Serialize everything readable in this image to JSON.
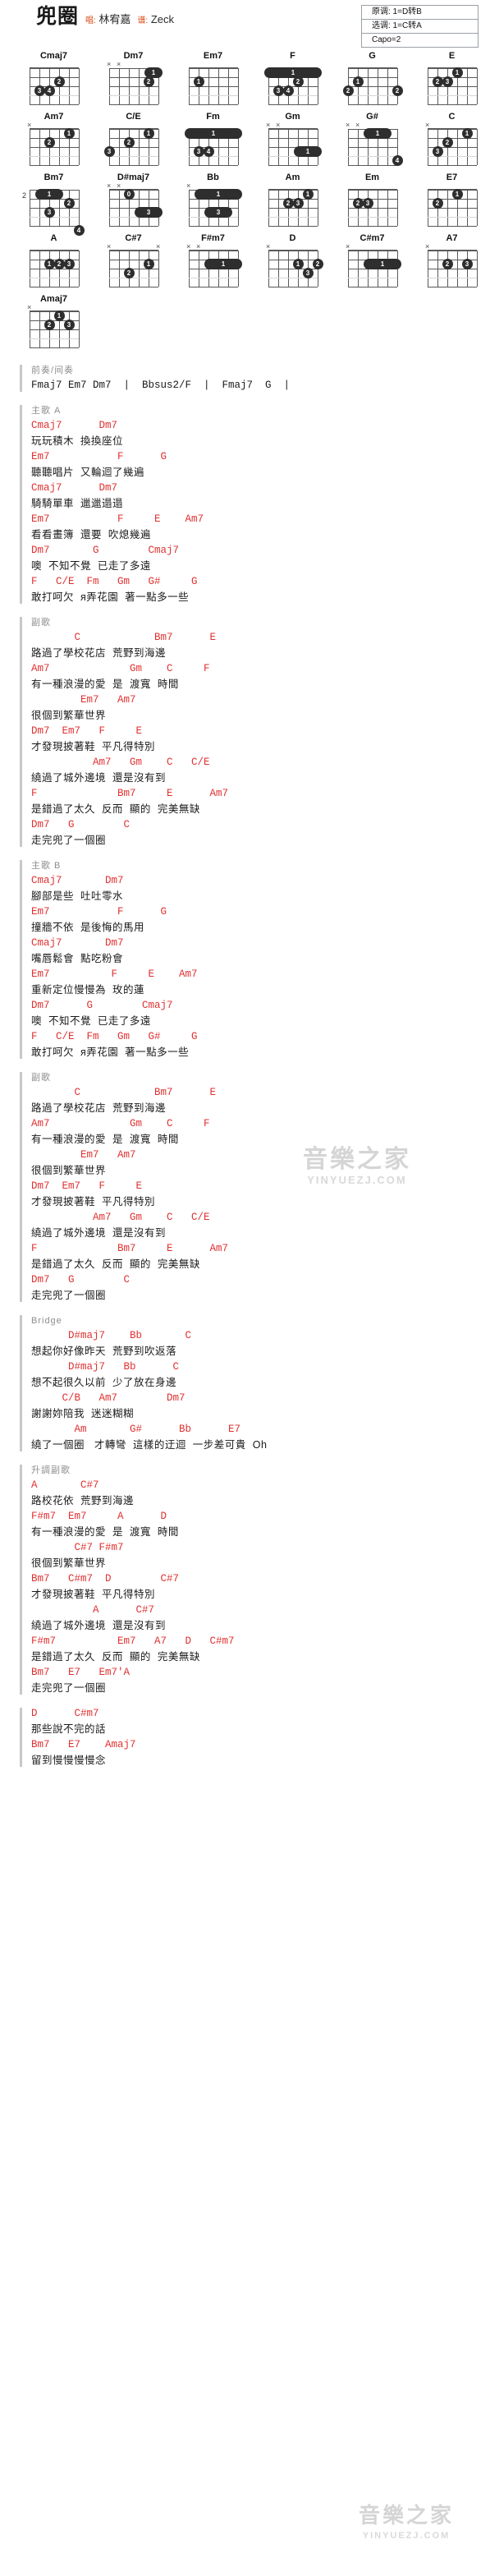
{
  "header": {
    "title": "兜圈",
    "singer_label": "唱:",
    "singer": "林宥嘉",
    "arranger_label": "谱:",
    "arranger": "Zeck",
    "key_original": "原调: 1=D转B",
    "key_selected": "选调: 1=C转A",
    "capo": "Capo=2"
  },
  "chords": [
    [
      {
        "name": "Cmaj7",
        "mutes": [],
        "fret": "",
        "dots": [
          {
            "s": 3,
            "f": 2,
            "n": "2"
          },
          {
            "s": 5,
            "f": 3,
            "n": "3"
          },
          {
            "s": 4,
            "f": 3,
            "n": "4"
          }
        ],
        "bars": []
      },
      {
        "name": "Dm7",
        "mutes": [
          6,
          5
        ],
        "fret": "",
        "dots": [
          {
            "s": 2,
            "f": 2,
            "n": "2"
          }
        ],
        "bars": [
          {
            "f": 1,
            "from": 1,
            "to": 2,
            "n": "1"
          }
        ]
      },
      {
        "name": "Em7",
        "mutes": [],
        "fret": "",
        "dots": [
          {
            "s": 5,
            "f": 2,
            "n": "1"
          }
        ],
        "bars": []
      },
      {
        "name": "F",
        "mutes": [],
        "fret": "",
        "dots": [
          {
            "s": 3,
            "f": 2,
            "n": "2"
          },
          {
            "s": 5,
            "f": 3,
            "n": "3"
          },
          {
            "s": 4,
            "f": 3,
            "n": "4"
          }
        ],
        "bars": [
          {
            "f": 1,
            "from": 1,
            "to": 6,
            "n": "1"
          }
        ]
      },
      {
        "name": "G",
        "mutes": [],
        "fret": "",
        "dots": [
          {
            "s": 5,
            "f": 2,
            "n": "1"
          },
          {
            "s": 6,
            "f": 3,
            "n": "2"
          },
          {
            "s": 1,
            "f": 3,
            "n": "2"
          }
        ],
        "bars": []
      },
      {
        "name": "E",
        "mutes": [],
        "fret": "",
        "dots": [
          {
            "s": 3,
            "f": 1,
            "n": "1"
          },
          {
            "s": 5,
            "f": 2,
            "n": "2"
          },
          {
            "s": 4,
            "f": 2,
            "n": "3"
          }
        ],
        "bars": []
      }
    ],
    [
      {
        "name": "Am7",
        "mutes": [
          6
        ],
        "fret": "",
        "dots": [
          {
            "s": 2,
            "f": 1,
            "n": "1"
          },
          {
            "s": 4,
            "f": 2,
            "n": "2"
          }
        ],
        "bars": []
      },
      {
        "name": "C/E",
        "mutes": [],
        "fret": "",
        "dots": [
          {
            "s": 2,
            "f": 1,
            "n": "1"
          },
          {
            "s": 4,
            "f": 2,
            "n": "2"
          },
          {
            "s": 6,
            "f": 3,
            "n": "3"
          }
        ],
        "bars": []
      },
      {
        "name": "Fm",
        "mutes": [],
        "fret": "",
        "dots": [
          {
            "s": 5,
            "f": 3,
            "n": "3"
          },
          {
            "s": 4,
            "f": 3,
            "n": "4"
          }
        ],
        "bars": [
          {
            "f": 1,
            "from": 1,
            "to": 6,
            "n": "1"
          }
        ]
      },
      {
        "name": "Gm",
        "mutes": [
          6,
          5
        ],
        "fret": "",
        "dots": [],
        "bars": [
          {
            "f": 3,
            "from": 1,
            "to": 3,
            "n": "1"
          }
        ]
      },
      {
        "name": "G#",
        "mutes": [
          6,
          5
        ],
        "fret": "",
        "dots": [
          {
            "s": 1,
            "f": 4,
            "n": "4"
          }
        ],
        "bars": [
          {
            "f": 1,
            "from": 2,
            "to": 4,
            "n": "1"
          }
        ]
      },
      {
        "name": "C",
        "mutes": [
          6
        ],
        "fret": "",
        "dots": [
          {
            "s": 2,
            "f": 1,
            "n": "1"
          },
          {
            "s": 4,
            "f": 2,
            "n": "2"
          },
          {
            "s": 5,
            "f": 3,
            "n": "3"
          }
        ],
        "bars": []
      }
    ],
    [
      {
        "name": "Bm7",
        "mutes": [],
        "fret": "2",
        "dots": [
          {
            "s": 2,
            "f": 2,
            "n": "2"
          },
          {
            "s": 4,
            "f": 3,
            "n": "3"
          },
          {
            "s": 1,
            "f": 5,
            "n": "4"
          }
        ],
        "bars": [
          {
            "f": 1,
            "from": 3,
            "to": 5,
            "n": "1"
          }
        ]
      },
      {
        "name": "D#maj7",
        "mutes": [
          6,
          5
        ],
        "fret": "",
        "dots": [
          {
            "s": 4,
            "f": 1,
            "n": "0"
          }
        ],
        "bars": [
          {
            "f": 3,
            "from": 1,
            "to": 3,
            "n": "3"
          }
        ]
      },
      {
        "name": "Bb",
        "mutes": [
          6
        ],
        "fret": "",
        "dots": [],
        "bars": [
          {
            "f": 1,
            "from": 1,
            "to": 5,
            "n": "1"
          },
          {
            "f": 3,
            "from": 2,
            "to": 4,
            "n": "3"
          }
        ]
      },
      {
        "name": "Am",
        "mutes": [],
        "fret": "",
        "dots": [
          {
            "s": 2,
            "f": 1,
            "n": "1"
          },
          {
            "s": 4,
            "f": 2,
            "n": "2"
          },
          {
            "s": 3,
            "f": 2,
            "n": "3"
          }
        ],
        "bars": []
      },
      {
        "name": "Em",
        "mutes": [],
        "fret": "",
        "dots": [
          {
            "s": 5,
            "f": 2,
            "n": "2"
          },
          {
            "s": 4,
            "f": 2,
            "n": "3"
          }
        ],
        "bars": []
      },
      {
        "name": "E7",
        "mutes": [],
        "fret": "",
        "dots": [
          {
            "s": 3,
            "f": 1,
            "n": "1"
          },
          {
            "s": 5,
            "f": 2,
            "n": "2"
          }
        ],
        "bars": []
      }
    ],
    [
      {
        "name": "A",
        "mutes": [],
        "fret": "",
        "dots": [
          {
            "s": 4,
            "f": 2,
            "n": "1"
          },
          {
            "s": 3,
            "f": 2,
            "n": "2"
          },
          {
            "s": 2,
            "f": 2,
            "n": "3"
          }
        ],
        "bars": []
      },
      {
        "name": "C#7",
        "mutes": [
          6,
          1
        ],
        "fret": "",
        "dots": [
          {
            "s": 2,
            "f": 2,
            "n": "1"
          },
          {
            "s": 4,
            "f": 3,
            "n": "2"
          }
        ],
        "bars": []
      },
      {
        "name": "F#m7",
        "mutes": [
          6,
          5
        ],
        "fret": "",
        "dots": [],
        "bars": [
          {
            "f": 2,
            "from": 1,
            "to": 4,
            "n": "1"
          }
        ]
      },
      {
        "name": "D",
        "mutes": [
          6
        ],
        "fret": "",
        "dots": [
          {
            "s": 3,
            "f": 2,
            "n": "1"
          },
          {
            "s": 1,
            "f": 2,
            "n": "2"
          },
          {
            "s": 2,
            "f": 3,
            "n": "3"
          }
        ],
        "bars": []
      },
      {
        "name": "C#m7",
        "mutes": [
          6
        ],
        "fret": "",
        "dots": [],
        "bars": [
          {
            "f": 2,
            "from": 1,
            "to": 4,
            "n": "1"
          }
        ]
      },
      {
        "name": "A7",
        "mutes": [
          6
        ],
        "fret": "",
        "dots": [
          {
            "s": 4,
            "f": 2,
            "n": "2"
          },
          {
            "s": 2,
            "f": 2,
            "n": "3"
          }
        ],
        "bars": []
      }
    ],
    [
      {
        "name": "Amaj7",
        "mutes": [
          6
        ],
        "fret": "",
        "dots": [
          {
            "s": 3,
            "f": 1,
            "n": "1"
          },
          {
            "s": 4,
            "f": 2,
            "n": "2"
          },
          {
            "s": 2,
            "f": 2,
            "n": "3"
          }
        ],
        "bars": []
      }
    ]
  ],
  "sections": [
    {
      "label": "前奏/间奏",
      "lines": [
        {
          "type": "interlude",
          "text": "Fmaj7 Em7 Dm7  |  Bbsus2/F  |  Fmaj7  G  |"
        }
      ]
    },
    {
      "label": "主歌 A",
      "lines": [
        {
          "type": "chords",
          "text": "Cmaj7      Dm7"
        },
        {
          "type": "lyric",
          "text": "玩玩積木  換換座位"
        },
        {
          "type": "chords",
          "text": "Em7           F      G"
        },
        {
          "type": "lyric",
          "text": "聽聽唱片  又輪迴了幾遍"
        },
        {
          "type": "chords",
          "text": "Cmaj7      Dm7"
        },
        {
          "type": "lyric",
          "text": "騎騎單車  邋邋遢遢"
        },
        {
          "type": "chords",
          "text": "Em7           F     E    Am7"
        },
        {
          "type": "lyric",
          "text": "看看畫簿  還要  吹熄幾遍"
        },
        {
          "type": "chords",
          "text": "Dm7       G        Cmaj7"
        },
        {
          "type": "lyric",
          "text": "噢  不知不覺  已走了多遠"
        },
        {
          "type": "chords",
          "text": "F   C/E  Fm   Gm   G#     G"
        },
        {
          "type": "lyric",
          "text": "敢打呵欠  я弄花園  著一點多一些"
        }
      ]
    },
    {
      "label": "副歌",
      "lines": [
        {
          "type": "chords",
          "text": "       C            Bm7      E"
        },
        {
          "type": "lyric",
          "text": "路過了學校花店  荒野到海邊"
        },
        {
          "type": "chords",
          "text": "Am7             Gm    C     F"
        },
        {
          "type": "lyric",
          "text": "有一種浪漫的愛  是  渡寬  時間"
        },
        {
          "type": "chords",
          "text": "        Em7   Am7"
        },
        {
          "type": "lyric",
          "text": "很個到繁華世界"
        },
        {
          "type": "chords",
          "text": "Dm7  Em7   F     E"
        },
        {
          "type": "lyric",
          "text": "才發現披著鞋  平凡得特別"
        },
        {
          "type": "chords",
          "text": "          Am7   Gm    C   C/E"
        },
        {
          "type": "lyric",
          "text": "繞過了城外邊境  還是沒有到"
        },
        {
          "type": "chords",
          "text": "F             Bm7     E      Am7"
        },
        {
          "type": "lyric",
          "text": "是錯過了太久  反而  顯的  完美無缺"
        },
        {
          "type": "chords",
          "text": "Dm7   G        C"
        },
        {
          "type": "lyric",
          "text": "走完兜了一個圈"
        }
      ]
    },
    {
      "label": "主歌 B",
      "lines": [
        {
          "type": "chords",
          "text": "Cmaj7       Dm7"
        },
        {
          "type": "lyric",
          "text": "腳部是些  吐吐零水"
        },
        {
          "type": "chords",
          "text": "Em7           F      G"
        },
        {
          "type": "lyric",
          "text": "撞牆不依  是後悔的馬用"
        },
        {
          "type": "chords",
          "text": "Cmaj7       Dm7"
        },
        {
          "type": "lyric",
          "text": "嘴唇鬆會  點吃粉會"
        },
        {
          "type": "chords",
          "text": "Em7          F     E    Am7"
        },
        {
          "type": "lyric",
          "text": "重新定位慢慢為  玫的蓮"
        },
        {
          "type": "chords",
          "text": "Dm7      G        Cmaj7"
        },
        {
          "type": "lyric",
          "text": "噢  不知不覺  已走了多遠"
        },
        {
          "type": "chords",
          "text": "F   C/E  Fm   Gm   G#     G"
        },
        {
          "type": "lyric",
          "text": "敢打呵欠  я弄花園  著一點多一些"
        }
      ]
    },
    {
      "label": "副歌",
      "lines": [
        {
          "type": "chords",
          "text": "       C            Bm7      E"
        },
        {
          "type": "lyric",
          "text": "路過了學校花店  荒野到海邊"
        },
        {
          "type": "chords",
          "text": "Am7             Gm    C     F"
        },
        {
          "type": "lyric",
          "text": "有一種浪漫的愛  是  渡寬  時間"
        },
        {
          "type": "chords",
          "text": "        Em7   Am7"
        },
        {
          "type": "lyric",
          "text": "很個到繁華世界"
        },
        {
          "type": "chords",
          "text": "Dm7  Em7   F     E"
        },
        {
          "type": "lyric",
          "text": "才發現披著鞋  平凡得特別"
        },
        {
          "type": "chords",
          "text": "          Am7   Gm    C   C/E"
        },
        {
          "type": "lyric",
          "text": "繞過了城外邊境  還是沒有到"
        },
        {
          "type": "chords",
          "text": "F             Bm7     E      Am7"
        },
        {
          "type": "lyric",
          "text": "是錯過了太久  反而  顯的  完美無缺"
        },
        {
          "type": "chords",
          "text": "Dm7   G        C"
        },
        {
          "type": "lyric",
          "text": "走完兜了一個圈"
        }
      ]
    },
    {
      "label": "Bridge",
      "lines": [
        {
          "type": "chords",
          "text": "      D#maj7    Bb       C"
        },
        {
          "type": "lyric",
          "text": "想起你好像昨天  荒野到吹返落"
        },
        {
          "type": "chords",
          "text": "      D#maj7   Bb      C"
        },
        {
          "type": "lyric",
          "text": "想不起很久以前  少了放在身邊"
        },
        {
          "type": "chords",
          "text": "     C/B   Am7        Dm7"
        },
        {
          "type": "lyric",
          "text": "謝謝妳陪我  迷迷糊糊"
        },
        {
          "type": "chords",
          "text": "       Am       G#      Bb      E7"
        },
        {
          "type": "lyric",
          "text": "繞了一個圈   才轉彎  這樣的迂迴  一步差可貴  Oh"
        }
      ]
    },
    {
      "label": "升調副歌",
      "lines": [
        {
          "type": "chords",
          "text": "A       C#7"
        },
        {
          "type": "lyric",
          "text": "路校花依  荒野到海邊"
        },
        {
          "type": "chords",
          "text": "F#m7  Em7     A      D"
        },
        {
          "type": "lyric",
          "text": "有一種浪漫的愛  是  渡寬  時間"
        },
        {
          "type": "chords",
          "text": "       C#7 F#m7"
        },
        {
          "type": "lyric",
          "text": "很個到繁華世界"
        },
        {
          "type": "chords",
          "text": "Bm7   C#m7  D        C#7"
        },
        {
          "type": "lyric",
          "text": "才發現披著鞋  平凡得特別"
        },
        {
          "type": "chords",
          "text": "          A      C#7"
        },
        {
          "type": "lyric",
          "text": "繞過了城外邊境  還是沒有到"
        },
        {
          "type": "chords",
          "text": "F#m7          Em7   A7   D   C#m7"
        },
        {
          "type": "lyric",
          "text": "是錯過了太久  反而  顯的  完美無缺"
        },
        {
          "type": "chords",
          "text": "Bm7   E7   Em7'A"
        },
        {
          "type": "lyric",
          "text": "走完兜了一個圈"
        }
      ]
    },
    {
      "label": "",
      "lines": [
        {
          "type": "chords",
          "text": "D      C#m7"
        },
        {
          "type": "lyric",
          "text": "那些說不完的話"
        },
        {
          "type": "chords",
          "text": "Bm7   E7    Amaj7"
        },
        {
          "type": "lyric",
          "text": "留到慢慢慢慢念"
        }
      ]
    }
  ],
  "watermark": {
    "cn": "音樂之家",
    "en": "YINYUEZJ.COM"
  }
}
